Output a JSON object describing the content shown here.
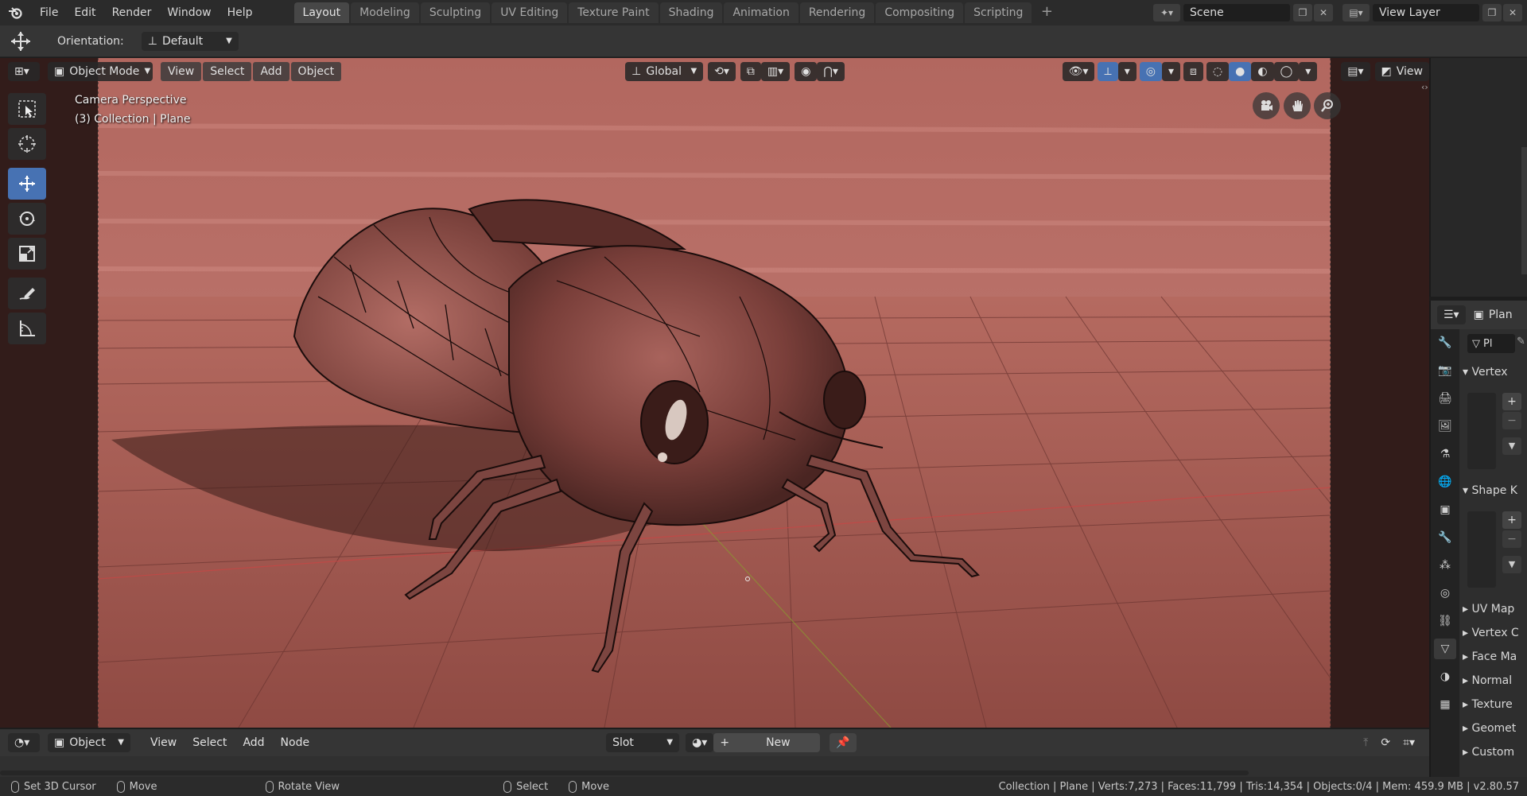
{
  "menu": [
    "File",
    "Edit",
    "Render",
    "Window",
    "Help"
  ],
  "workspaces": [
    "Layout",
    "Modeling",
    "Sculpting",
    "UV Editing",
    "Texture Paint",
    "Shading",
    "Animation",
    "Rendering",
    "Compositing",
    "Scripting"
  ],
  "active_workspace": "Layout",
  "scene": {
    "label": "Scene"
  },
  "view_layer": {
    "label": "View Layer"
  },
  "tool_header": {
    "orientation_label": "Orientation:",
    "orientation_value": "Default"
  },
  "viewport_header": {
    "mode": "Object Mode",
    "menus": [
      "View",
      "Select",
      "Add",
      "Object"
    ],
    "transform": "Global",
    "view_btn": "View"
  },
  "overlay": {
    "line1": "Camera Perspective",
    "line2": "(3) Collection | Plane"
  },
  "properties": {
    "object_name": "Plan",
    "data_name": "Pl",
    "panels": {
      "vertex_groups": "Vertex",
      "shape_keys": "Shape K",
      "uv_maps": "UV Map",
      "vertex_colors": "Vertex C",
      "face_maps": "Face Ma",
      "normals": "Normal",
      "texture_space": "Texture",
      "geometry": "Geomet",
      "custom": "Custom"
    }
  },
  "shader_header": {
    "editor": "Object",
    "menus": [
      "View",
      "Select",
      "Add",
      "Node"
    ],
    "slot": "Slot",
    "new": "New"
  },
  "status": {
    "hints": [
      "Set 3D Cursor",
      "Move",
      "Rotate View",
      "Select",
      "Move"
    ],
    "info": "Collection | Plane | Verts:7,273 | Faces:11,799 | Tris:14,354 | Objects:0/4 | Mem: 459.9 MB | v2.80.57"
  },
  "colors": {
    "accent": "#4772b3",
    "floor": "#a85a52",
    "wall": "#b36a63"
  }
}
